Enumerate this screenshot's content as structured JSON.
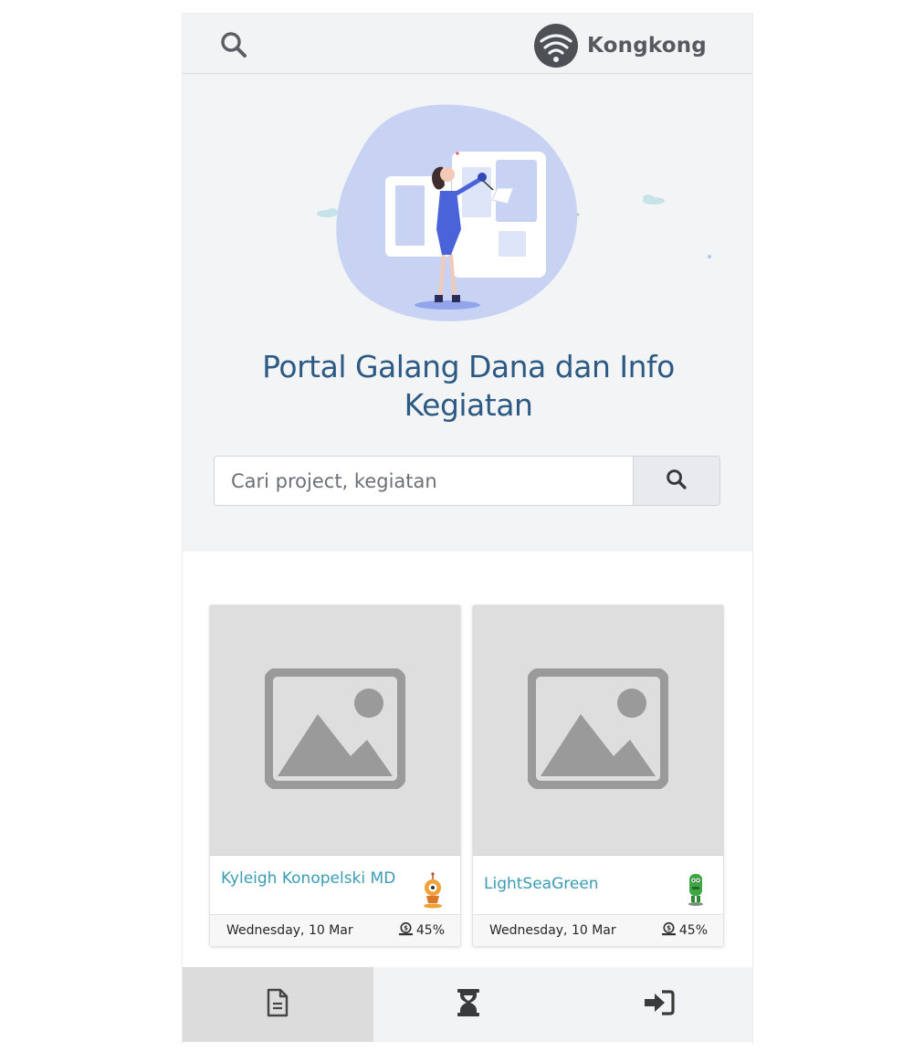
{
  "header": {
    "search_icon": "search-icon",
    "brand_name": "Kongkong",
    "logo_icon": "kongkong-logo"
  },
  "hero": {
    "illustration": "presentation-illustration",
    "title_line1": "Portal Galang Dana dan Info",
    "title_line2": "Kegiatan",
    "search": {
      "placeholder": "Cari project, kegiatan",
      "value": "",
      "button_icon": "search-icon"
    }
  },
  "cards": [
    {
      "name": "Kyleigh Konopelski MD",
      "date": "Wednesday, 10 Mar",
      "progress": "45%",
      "progress_icon": "money-icon",
      "avatar_icon": "orange-robot-avatar",
      "thumbnail_icon": "image-placeholder-icon"
    },
    {
      "name": "LightSeaGreen",
      "date": "Wednesday, 10 Mar",
      "progress": "45%",
      "progress_icon": "money-icon",
      "avatar_icon": "green-robot-avatar",
      "thumbnail_icon": "image-placeholder-icon"
    }
  ],
  "bottom_nav": [
    {
      "icon": "document-icon",
      "active": true
    },
    {
      "icon": "hourglass-icon",
      "active": false
    },
    {
      "icon": "sign-in-icon",
      "active": false
    }
  ],
  "colors": {
    "title": "#2c5a83",
    "card_name": "#3a9bb5",
    "blob": "#c8d3f3",
    "accent_blue": "#4a6ee0"
  }
}
